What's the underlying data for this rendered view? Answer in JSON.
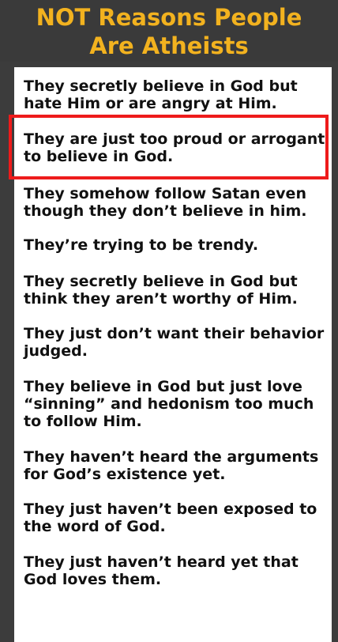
{
  "header": {
    "title_line1": "NOT Reasons People",
    "title_line2": "Are Atheists"
  },
  "reasons": [
    {
      "line1": "They secretly believe in God but",
      "line2": "hate Him or are angry at Him.",
      "highlighted": false
    },
    {
      "line1": "They are just too proud or arrogant",
      "line2": "to believe in God.",
      "highlighted": true
    },
    {
      "line1": "They somehow follow Satan even",
      "line2": "though they don’t believe in him.",
      "highlighted": false
    },
    {
      "line1": "They’re trying to be trendy.",
      "highlighted": false
    },
    {
      "line1": "They secretly believe in God but",
      "line2": "think they aren’t worthy of Him.",
      "highlighted": false
    },
    {
      "line1": "They just don’t want their behavior",
      "line2": "judged.",
      "highlighted": false
    },
    {
      "line1": "They believe in God but just love",
      "line2": "“sinning” and hedonism too much",
      "line3": "to follow Him.",
      "highlighted": false
    },
    {
      "line1": "They haven’t heard the arguments",
      "line2": "for God’s existence yet.",
      "highlighted": false
    },
    {
      "line1": "They just haven’t been exposed to",
      "line2": "the word of God.",
      "highlighted": false
    },
    {
      "line1": "They just haven’t heard yet that",
      "line2": "God loves them.",
      "highlighted": false
    }
  ],
  "colors": {
    "title": "#f2b21f",
    "header_background": "#3a3a3a",
    "panel_background": "#ffffff",
    "highlight_border": "#ee1b1b",
    "text": "#111111"
  }
}
